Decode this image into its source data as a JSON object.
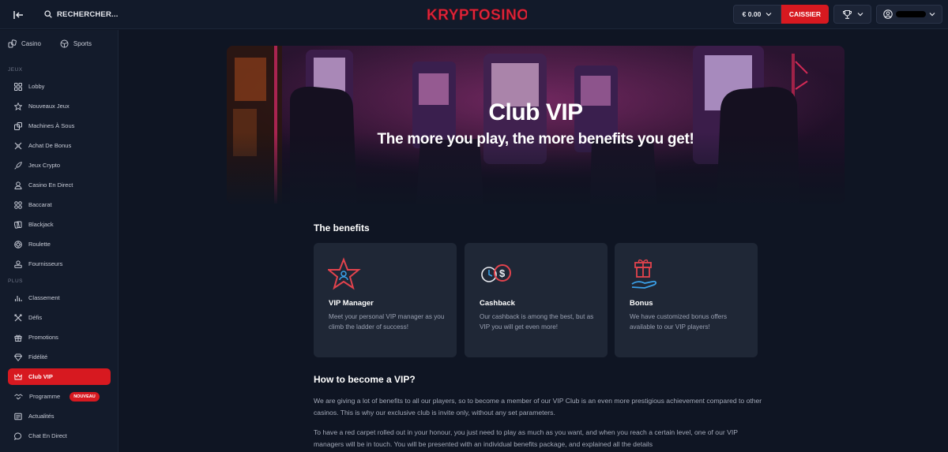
{
  "topbar": {
    "search_label": "RECHERCHER...",
    "logo_text": "KRYPTOSINO",
    "wallet_amount": "€ 0.00",
    "cashier_label": "CAISSIER"
  },
  "sidebar": {
    "top_links": [
      {
        "label": "Casino",
        "icon": "casino-icon"
      },
      {
        "label": "Sports",
        "icon": "sports-ball-icon"
      }
    ],
    "section_games": "JEUX",
    "games": [
      {
        "label": "Lobby",
        "icon": "grid-icon"
      },
      {
        "label": "Nouveaux Jeux",
        "icon": "star-icon"
      },
      {
        "label": "Machines À Sous",
        "icon": "slot-machine-icon"
      },
      {
        "label": "Achat De Bonus",
        "icon": "bonus-icon"
      },
      {
        "label": "Jeux Crypto",
        "icon": "rocket-icon"
      },
      {
        "label": "Casino En Direct",
        "icon": "live-dealer-icon"
      },
      {
        "label": "Baccarat",
        "icon": "baccarat-icon"
      },
      {
        "label": "Blackjack",
        "icon": "cards-icon"
      },
      {
        "label": "Roulette",
        "icon": "roulette-icon"
      },
      {
        "label": "Fournisseurs",
        "icon": "providers-icon"
      }
    ],
    "section_more": "PLUS",
    "more": [
      {
        "label": "Classement",
        "icon": "bar-chart-icon"
      },
      {
        "label": "Défis",
        "icon": "challenges-icon"
      },
      {
        "label": "Promotions",
        "icon": "gift-icon"
      },
      {
        "label": "Fidélité",
        "icon": "diamond-icon"
      },
      {
        "label": "Club VIP",
        "icon": "crown-icon",
        "active": true
      },
      {
        "label": "Programme",
        "icon": "handshake-icon",
        "badge": "NOUVEAU"
      },
      {
        "label": "Actualités",
        "icon": "news-icon"
      },
      {
        "label": "Chat En Direct",
        "icon": "chat-icon"
      }
    ]
  },
  "hero": {
    "title": "Club VIP",
    "subtitle": "The more you play, the more benefits you get!"
  },
  "benefits": {
    "heading": "The benefits",
    "cards": [
      {
        "title": "VIP Manager",
        "desc": "Meet your personal VIP manager as you climb the ladder of success!",
        "icon": "vip-star-icon"
      },
      {
        "title": "Cashback",
        "desc": "Our cashback is among the best, but as VIP you will get even more!",
        "icon": "cashback-icon"
      },
      {
        "title": "Bonus",
        "desc": "We have customized bonus offers available to our VIP players!",
        "icon": "gift-hand-icon"
      }
    ]
  },
  "howto": {
    "heading": "How to become a VIP?",
    "p1": "We are giving a lot of benefits to all our players, so to become a member of our VIP Club is an even more prestigious achievement compared to other casinos. This is why our exclusive club is invite only, without any set parameters.",
    "p2": "To have a red carpet rolled out in your honour, you just need to play as much as you want, and when you reach a certain level, one of our VIP managers will be in touch. You will be presented with an individual benefits package, and explained all the details"
  },
  "colors": {
    "accent": "#d71920",
    "background": "#0f1523",
    "card": "#1f2736"
  }
}
